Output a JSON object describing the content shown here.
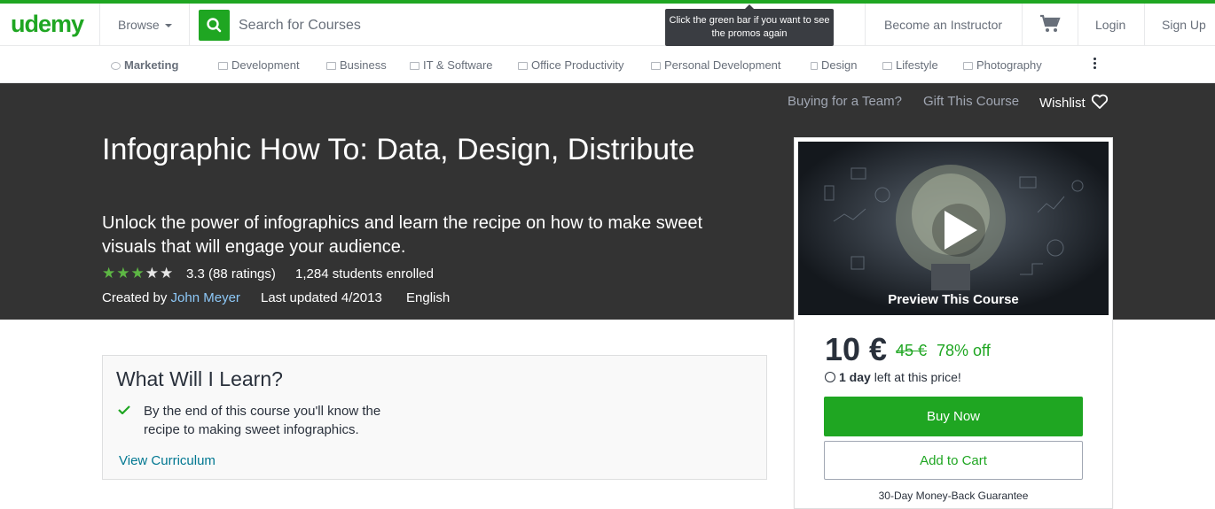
{
  "topnav": {
    "logo": "udemy",
    "browse_label": "Browse",
    "search_placeholder": "Search for Courses",
    "tooltip": "Click the green bar if you want to see the promos again",
    "become_instructor": "Become an Instructor",
    "login": "Login",
    "signup": "Sign Up"
  },
  "categories": [
    {
      "label": "Marketing",
      "active": true
    },
    {
      "label": "Development"
    },
    {
      "label": "Business"
    },
    {
      "label": "IT & Software"
    },
    {
      "label": "Office Productivity"
    },
    {
      "label": "Personal Development"
    },
    {
      "label": "Design"
    },
    {
      "label": "Lifestyle"
    },
    {
      "label": "Photography"
    }
  ],
  "hero": {
    "buying_team": "Buying for a Team?",
    "gift": "Gift This Course",
    "wishlist": "Wishlist",
    "title": "Infographic How To: Data, Design, Distribute",
    "subtitle": "Unlock the power of infographics and learn the recipe on how to make sweet visuals that will engage your audience.",
    "rating_value": 3.3,
    "rating_text": "3.3 (88 ratings)",
    "students": "1,284 students enrolled",
    "created_by": "Created by",
    "author": "John Meyer",
    "updated": "Last updated 4/2013",
    "language": "English"
  },
  "sidebar": {
    "preview_label": "Preview This Course",
    "price": "10 €",
    "old_price": "45 €",
    "discount": "78% off",
    "timer_bold": "1 day",
    "timer_rest": " left at this price!",
    "buy_now": "Buy Now",
    "add_to_cart": "Add to Cart",
    "guarantee": "30-Day Money-Back Guarantee"
  },
  "learn": {
    "title": "What Will I Learn?",
    "items": [
      "By the end of this course you'll know the recipe to making sweet infographics."
    ],
    "view_curriculum": "View Curriculum"
  },
  "colors": {
    "brand": "#1fa622",
    "hero_bg": "#333333",
    "link": "#007791",
    "author_link": "#8dc8f7"
  }
}
